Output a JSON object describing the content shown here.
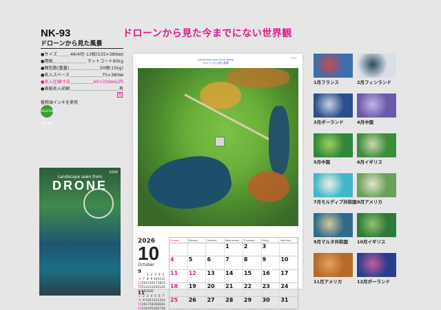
{
  "product": {
    "code": "NK-93",
    "name": "ドローンから見た風景",
    "headline": "ドローンから見た今までにない世界観",
    "specs": [
      {
        "label": "●サイズ",
        "value": "46/4切･13枚(535×380㎜)",
        "highlight": false
      },
      {
        "label": "●用紙",
        "value": "マットコート90kg",
        "highlight": false
      },
      {
        "label": "●梱包数(重量)",
        "value": "50冊(15kg)",
        "highlight": false
      },
      {
        "label": "●名入スペース",
        "value": "75×380㎜",
        "highlight": false
      },
      {
        "label": "●名入圧縮寸法",
        "value": "60×330㎜以内",
        "highlight": true
      },
      {
        "label": "●表紙名入印刷",
        "value": "有",
        "highlight": false
      }
    ],
    "mark": "名",
    "ink_note": "植物油インキを使用",
    "ink_logo": "VEGETABLE OIL INK"
  },
  "cover": {
    "subtitle": "Landscape seen from",
    "title": "DRONE",
    "year": "2026"
  },
  "main_page": {
    "title_en": "Landscape seen from drone",
    "title_jp": "ドローンから見た風景",
    "corner": "NK-93",
    "footer": "2026",
    "month_header": {
      "year": "2026",
      "month": "10",
      "month_en": "October"
    },
    "day_names": [
      "Sunday",
      "Monday",
      "Tuesday",
      "Wednesday",
      "Thursday",
      "Friday",
      "Saturday"
    ],
    "weeks": [
      [
        "",
        "",
        "",
        "1",
        "2",
        "3",
        ""
      ],
      [
        "4",
        "5",
        "6",
        "7",
        "8",
        "9",
        "10"
      ],
      [
        "11",
        "12",
        "13",
        "14",
        "15",
        "16",
        "17"
      ],
      [
        "18",
        "19",
        "20",
        "21",
        "22",
        "23",
        "24"
      ],
      [
        "25",
        "26",
        "27",
        "28",
        "29",
        "30",
        "31"
      ]
    ],
    "holidays": [
      "12"
    ],
    "mini_prev": {
      "month": "9",
      "rows": [
        [
          "",
          "",
          "1",
          "2",
          "3",
          "4",
          "5"
        ],
        [
          "6",
          "7",
          "8",
          "9",
          "10",
          "11",
          "12"
        ],
        [
          "13",
          "14",
          "15",
          "16",
          "17",
          "18",
          "19"
        ],
        [
          "20",
          "21",
          "22",
          "23",
          "24",
          "25",
          "26"
        ],
        [
          "27",
          "28",
          "29",
          "30",
          "",
          "",
          ""
        ]
      ]
    },
    "mini_next": {
      "month": "11",
      "rows": [
        [
          "1",
          "2",
          "3",
          "4",
          "5",
          "6",
          "7"
        ],
        [
          "8",
          "9",
          "10",
          "11",
          "12",
          "13",
          "14"
        ],
        [
          "15",
          "16",
          "17",
          "18",
          "19",
          "20",
          "21"
        ],
        [
          "22",
          "23",
          "24",
          "25",
          "26",
          "27",
          "28"
        ],
        [
          "29",
          "30",
          "",
          "",
          "",
          "",
          ""
        ]
      ]
    }
  },
  "thumbnails": [
    {
      "caption": "1月フランス",
      "color": "#3a6fb0",
      "accent": "#c94a4a"
    },
    {
      "caption": "2月フィンランド",
      "color": "#d9dfe6",
      "accent": "#2c4a5e"
    },
    {
      "caption": "3月ポーランド",
      "color": "#2a4f8a",
      "accent": "#c7d2e0"
    },
    {
      "caption": "4月中国",
      "color": "#6a5aa8",
      "accent": "#c3b3e6"
    },
    {
      "caption": "5月中国",
      "color": "#2e8a3a",
      "accent": "#9fd05a"
    },
    {
      "caption": "6月イギリス",
      "color": "#3d8c3a",
      "accent": "#c9d7b4"
    },
    {
      "caption": "7月モルディブ共和国",
      "color": "#3fb8c9",
      "accent": "#f1efe4"
    },
    {
      "caption": "8月アメリカ",
      "color": "#6aa05a",
      "accent": "#e0e6c9"
    },
    {
      "caption": "9月マルタ共和国",
      "color": "#2f6c8c",
      "accent": "#d7c59a"
    },
    {
      "caption": "10月イギリス",
      "color": "#2f7a3a",
      "accent": "#8fc36a"
    },
    {
      "caption": "11月アメリカ",
      "color": "#b66a2a",
      "accent": "#e3a25a"
    },
    {
      "caption": "12月ポーランド",
      "color": "#2a3f8a",
      "accent": "#c55aa0"
    }
  ]
}
